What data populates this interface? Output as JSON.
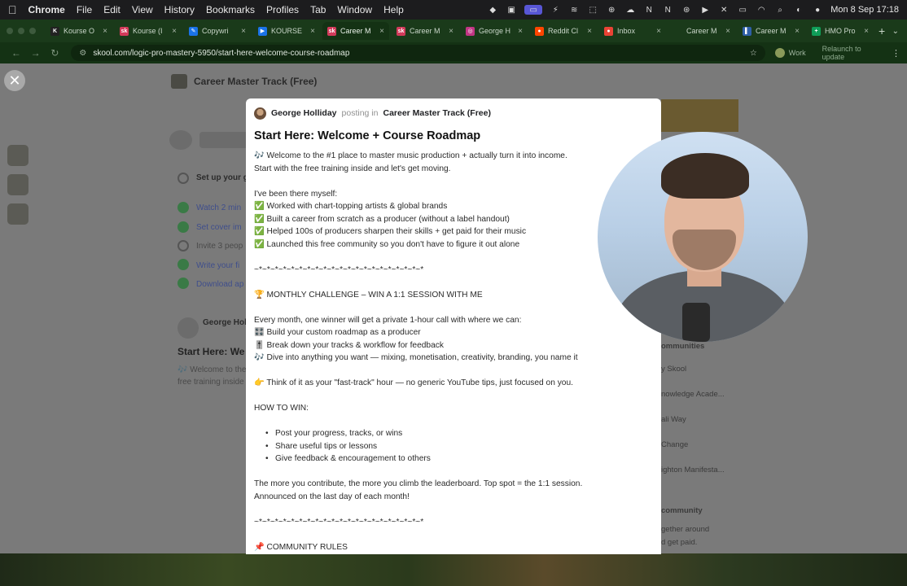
{
  "menubar": {
    "app": "Chrome",
    "items": [
      "File",
      "Edit",
      "View",
      "History",
      "Bookmarks",
      "Profiles",
      "Tab",
      "Window",
      "Help"
    ],
    "clock": "Mon 8 Sep  17:18"
  },
  "tabs": [
    {
      "label": "Kourse O",
      "color": "#222222",
      "glyph": "K"
    },
    {
      "label": "Kourse (I",
      "color": "#d23a5a",
      "glyph": "sk"
    },
    {
      "label": "Copywri",
      "color": "#1a73e8",
      "glyph": "✎"
    },
    {
      "label": "KOURSE",
      "color": "#1a73e8",
      "glyph": "▶"
    },
    {
      "label": "Career M",
      "color": "#d23a5a",
      "glyph": "sk",
      "active": true
    },
    {
      "label": "Career M",
      "color": "#d23a5a",
      "glyph": "sk"
    },
    {
      "label": "George H",
      "color": "#c13584",
      "glyph": "◎"
    },
    {
      "label": "Reddit Cl",
      "color": "#ff4500",
      "glyph": "●"
    },
    {
      "label": "Inbox",
      "color": "#ea4335",
      "glyph": "●"
    },
    {
      "label": "Career M",
      "color": "#1a3a1a",
      "glyph": ""
    },
    {
      "label": "Career M",
      "color": "#2f5fa8",
      "glyph": "▌"
    },
    {
      "label": "HMO Pro",
      "color": "#0f9d58",
      "glyph": "+"
    }
  ],
  "address_bar": {
    "url": "skool.com/logic-pro-mastery-5950/start-here-welcome-course-roadmap",
    "profile": "Work",
    "relaunch": "Relaunch to update"
  },
  "backdrop": {
    "group_title": "Career Master Track (Free)",
    "setup_heading": "Set up your g",
    "checklist": [
      "Watch 2 min",
      "Set cover im",
      "Invite 3 peop",
      "Write your fi",
      "Download ap"
    ],
    "post_author": "George Holl",
    "post_title": "Start Here: We",
    "post_snippet_1": "🎶 Welcome to the",
    "post_snippet_2": "free training inside",
    "right_items": [
      "ommunities",
      "y Skool",
      "nowledge Acade...",
      "ali Way",
      "Change",
      "ighton Manifesta..."
    ],
    "right_footer_title": "community",
    "right_footer_text_1": "gether around",
    "right_footer_text_2": "d get paid."
  },
  "post": {
    "author": "George Holliday",
    "posting_in": "posting in",
    "group": "Career Master Track (Free)",
    "title": "Start Here: Welcome + Course Roadmap",
    "lines": [
      "🎶 Welcome to the #1 place to master music production + actually turn it into income.",
      "Start with the free training inside and let's get moving.",
      "",
      "I've been there myself:",
      "✅ Worked with chart-topping artists & global brands",
      "✅ Built a career from scratch as a producer (without a label handout)",
      "✅ Helped 100s of producers sharpen their skills + get paid for their music",
      "✅ Launched this free community so you don't have to figure it out alone",
      "",
      "~*~*~*~*~*~*~*~*~*~*~*~*~*~*~*~*~*~*~*~*~*",
      "",
      "🏆 MONTHLY CHALLENGE – WIN A 1:1 SESSION WITH ME",
      "",
      "Every month, one winner will get a private 1-hour call with where we can:",
      "🎛️ Build your custom roadmap as a producer",
      "🎚️ Break down your tracks & workflow for feedback",
      "🎶 Dive into anything you want — mixing, monetisation, creativity, branding, you name it",
      "",
      "👉 Think of it as your \"fast-track\" hour — no generic YouTube tips, just focused on you.",
      "",
      "HOW TO WIN:",
      ""
    ],
    "bullets": [
      "Post your progress, tracks, or wins",
      "Share useful tips or lessons",
      "Give feedback & encouragement to others"
    ],
    "lines_after": [
      "",
      "The more you contribute, the more you climb the leaderboard. Top spot = the 1:1 session.",
      "Announced on the last day of each month!",
      "",
      "~*~*~*~*~*~*~*~*~*~*~*~*~*~*~*~*~*~*~*~*~*",
      "",
      "📌 COMMUNITY RULES"
    ]
  }
}
